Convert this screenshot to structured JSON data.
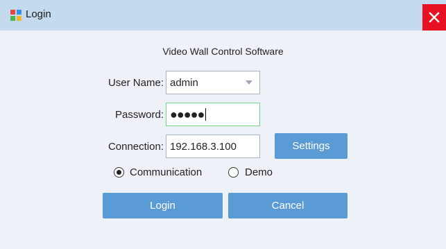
{
  "window": {
    "title": "Login",
    "close_icon": "close-icon",
    "app_icon": "app-logo-icon",
    "close_color": "#e81123",
    "titlebar_color": "#c4daef"
  },
  "form": {
    "heading": "Video Wall Control Software",
    "username": {
      "label": "User Name:",
      "value": "admin"
    },
    "password": {
      "label": "Password:",
      "value": "●●●●●"
    },
    "connection": {
      "label": "Connection:",
      "value": "192.168.3.100"
    },
    "settings_label": "Settings",
    "mode": {
      "options": [
        "Communication",
        "Demo"
      ],
      "selected": "Communication"
    },
    "login_label": "Login",
    "cancel_label": "Cancel"
  },
  "colors": {
    "button": "#5b9bd5",
    "focus_border": "#6fd38a",
    "background": "#eef2f8"
  }
}
